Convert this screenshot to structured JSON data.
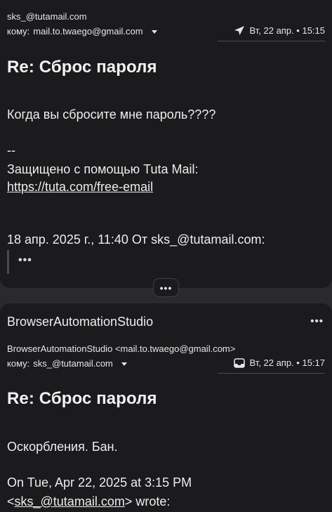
{
  "message1": {
    "from": "sks_@tutamail.com",
    "to_label": "кому:",
    "to": "mail.to.twaego@gmail.com",
    "meta_icon": "sent-arrow-icon",
    "date": "Вт, 22 апр. • 15:15",
    "subject": "Re: Сброс пароля",
    "body": {
      "question": "Когда вы сбросите мне пароль????",
      "dash": "--",
      "signature": "Защищено с помощью Tuta Mail:",
      "link": "https://tuta.com/free-email",
      "quote_header": "18 апр. 2025 г., 11:40 От sks_@tutamail.com:",
      "quote_dots": "•••"
    }
  },
  "collapse_button": "•••",
  "message2": {
    "sender_name": "BrowserAutomationStudio",
    "more": "•••",
    "from": "BrowserAutomationStudio <mail.to.twaego@gmail.com>",
    "to_label": "кому:",
    "to": "sks_@tutamail.com",
    "meta_icon": "inbox-tray-icon",
    "date": "Вт, 22 апр. • 15:17",
    "subject": "Re: Сброс пароля",
    "body": {
      "line1": "Оскорбления. Бан.",
      "line2": "On Tue, Apr 22, 2025 at 3:15 PM",
      "line3_open": "<",
      "line3_email": "sks_@tutamail.com",
      "line3_close": "> wrote:"
    }
  }
}
